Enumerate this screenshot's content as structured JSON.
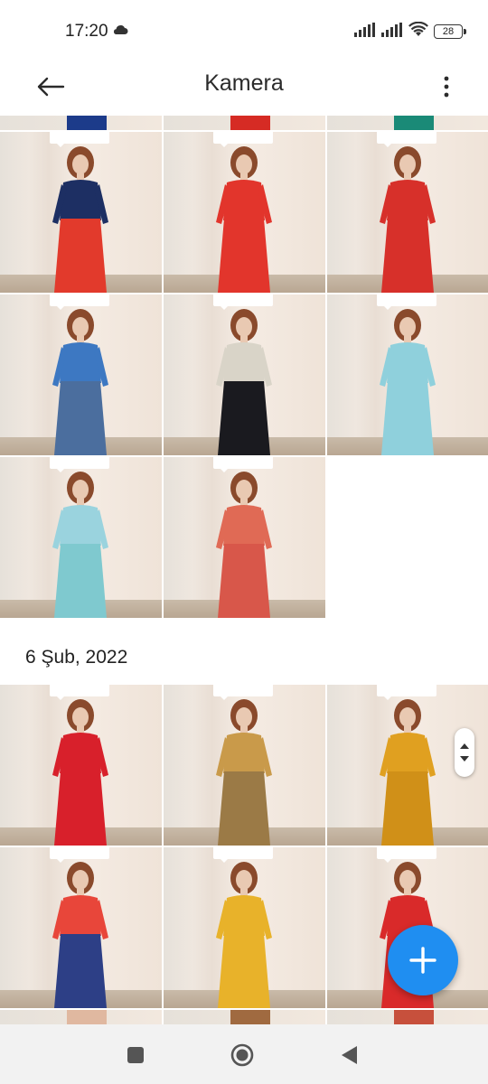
{
  "status_bar": {
    "time": "17:20",
    "battery": "28"
  },
  "app_bar": {
    "title": "Kamera"
  },
  "sections": [
    {
      "date": "",
      "photos": [
        {
          "top": "#1c3b8a",
          "bottom": "#1c3b8a"
        },
        {
          "top": "#d62b24",
          "bottom": "#d62b24"
        },
        {
          "top": "#1a8a77",
          "bottom": "#1a8a77"
        },
        {
          "top": "#1d2f63",
          "bottom": "#e23a2c"
        },
        {
          "top": "#e2352c",
          "bottom": "#e2352c"
        },
        {
          "top": "#d7302a",
          "bottom": "#d7302a"
        },
        {
          "top": "#3d78c2",
          "bottom": "#4b6e9e"
        },
        {
          "top": "#d9d4c8",
          "bottom": "#1a1a1f"
        },
        {
          "top": "#8fd0dc",
          "bottom": "#8fd0dc"
        },
        {
          "top": "#9ad3de",
          "bottom": "#7fc9cf"
        },
        {
          "top": "#e06a55",
          "bottom": "#d8574a"
        }
      ]
    },
    {
      "date": "6 Şub, 2022",
      "photos": [
        {
          "top": "#d8202b",
          "bottom": "#d8202b"
        },
        {
          "top": "#c99a4a",
          "bottom": "#9b7a46"
        },
        {
          "top": "#e0a020",
          "bottom": "#d09018"
        },
        {
          "top": "#e8463a",
          "bottom": "#2d3f86"
        },
        {
          "top": "#e8b22a",
          "bottom": "#e8b22a"
        },
        {
          "top": "#d92a2a",
          "bottom": "#d92a2a"
        }
      ]
    }
  ]
}
